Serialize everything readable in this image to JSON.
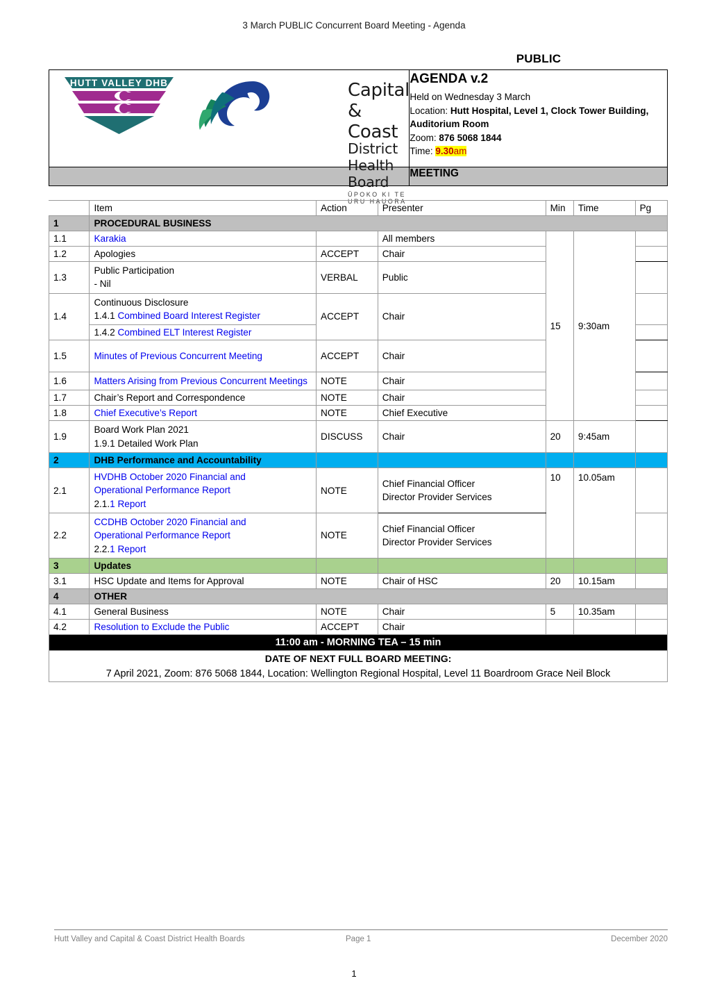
{
  "doc": {
    "running_header": "3 March PUBLIC Concurrent Board Meeting - Agenda",
    "public_label": "PUBLIC"
  },
  "masthead": {
    "logo_hutt": {
      "name": "hutt-valley-dhb-logo",
      "text": "HUTT VALLEY DHB"
    },
    "logo_ccdhb": {
      "name": "capital-and-coast-dhb-logo",
      "line1": "Capital & Coast",
      "line2": "District Health Board",
      "line3": "ŪPOKO KI TE URU HAUORA"
    },
    "agenda_title": "AGENDA v.2",
    "held_on": "Held on Wednesday 3 March",
    "location_label": "Location: ",
    "location_value": "Hutt Hospital, Level 1, Clock Tower Building, Auditorium Room",
    "zoom_label": "Zoom: ",
    "zoom_value": "876 5068 1844",
    "time_label": "Time: ",
    "time_value": "9.30",
    "time_suffix": "am",
    "meeting_bar": "MEETING"
  },
  "table": {
    "headers": {
      "num": "",
      "item": "Item",
      "action": "Action",
      "presenter": "Presenter",
      "min": "Min",
      "time": "Time",
      "pg": "Pg"
    },
    "sections": {
      "s1_num": "1",
      "s1_title": "PROCEDURAL BUSINESS",
      "s2_num": "2",
      "s2_title": "DHB Performance and Accountability",
      "s3_num": "3",
      "s3_title": "Updates",
      "s4_num": "4",
      "s4_title": "OTHER"
    },
    "rows": {
      "r11": {
        "num": "1.1",
        "item": "Karakia",
        "action": "",
        "presenter": "All members"
      },
      "r12": {
        "num": "1.2",
        "item": "Apologies",
        "action": "ACCEPT",
        "presenter": "Chair"
      },
      "r13": {
        "num": "1.3",
        "item_l1": "Public Participation",
        "item_l2": "- Nil",
        "action": "VERBAL",
        "presenter": "Public"
      },
      "r14": {
        "num": "1.4",
        "item_l1": "Continuous Disclosure",
        "item_l2_num": "1.4.1 ",
        "item_l2_link": "Combined Board Interest Register",
        "item_l3_num": "1.4.2 ",
        "item_l3_link": "Combined ELT Interest Register",
        "action": "ACCEPT",
        "presenter": "Chair"
      },
      "r15": {
        "num": "1.5",
        "item": "Minutes of Previous Concurrent Meeting",
        "action": "ACCEPT",
        "presenter": "Chair"
      },
      "r16": {
        "num": "1.6",
        "item": "Matters Arising from Previous Concurrent Meetings",
        "action": "NOTE",
        "presenter": "Chair"
      },
      "r17": {
        "num": "1.7",
        "item": "Chair’s Report and Correspondence",
        "action": "NOTE",
        "presenter": "Chair"
      },
      "r18": {
        "num": "1.8",
        "item": "Chief Executive’s Report",
        "action": "NOTE",
        "presenter": "Chief Executive"
      },
      "r19": {
        "num": "1.9",
        "item_l1": "Board Work Plan 2021",
        "item_l2": "1.9.1 Detailed Work Plan",
        "action": "DISCUSS",
        "presenter": "Chair",
        "min": "20",
        "time": "9:45am"
      },
      "r21": {
        "num": "2.1",
        "item_l1": "HVDHB October 2020 Financial and",
        "item_l2": "Operational Performance Report",
        "item_l3_num": "2.1.",
        "item_l3_link": "1 Report",
        "action": "NOTE",
        "presenter_l1": "Chief Financial Officer",
        "presenter_l2": "Director Provider Services",
        "min": "10",
        "time": "10.05am"
      },
      "r22": {
        "num": "2.2",
        "item_l1": "CCDHB October 2020 Financial and",
        "item_l2": "Operational Performance Report",
        "item_l3_num": "2.2.",
        "item_l3_link": "1 Report",
        "action": "NOTE",
        "presenter_l1": "Chief Financial Officer",
        "presenter_l2": "Director Provider Services"
      },
      "r31": {
        "num": "3.1",
        "item": "HSC Update and Items for Approval",
        "action": "NOTE",
        "presenter": "Chair of HSC",
        "min": "20",
        "time": "10.15am"
      },
      "r41": {
        "num": "4.1",
        "item": "General Business",
        "action": "NOTE",
        "presenter": "Chair",
        "min": "5",
        "time": "10.35am"
      },
      "r42": {
        "num": "4.2",
        "item": "Resolution to Exclude the Public",
        "action": "ACCEPT",
        "presenter": "Chair"
      }
    },
    "merged": {
      "min_block1": "15",
      "time_block1": "9:30am"
    },
    "banners": {
      "morning_tea": "11:00 am - MORNING TEA – 15 min",
      "next_meeting_title": "DATE OF NEXT FULL BOARD MEETING:",
      "next_meeting_detail": "7 April 2021, Zoom: 876 5068 1844, Location: Wellington Regional Hospital, Level 11 Boardroom Grace Neil Block"
    }
  },
  "footer": {
    "left": "Hutt Valley and Capital & Coast District Health Boards",
    "middle": "Page 1",
    "right": "December 2020",
    "page_number": "1"
  },
  "colors": {
    "section_grey": "#bfbfbf",
    "section_blue": "#00aeef",
    "section_green": "#a9d18e",
    "link_blue": "#0000ee",
    "highlight_yellow": "#ffff00",
    "highlight_text_red": "#c00000",
    "hutt_teal": "#1f6f72",
    "hutt_magenta": "#a02b8f",
    "ccdhb_blue": "#1c3f94",
    "ccdhb_green": "#17a06a"
  }
}
